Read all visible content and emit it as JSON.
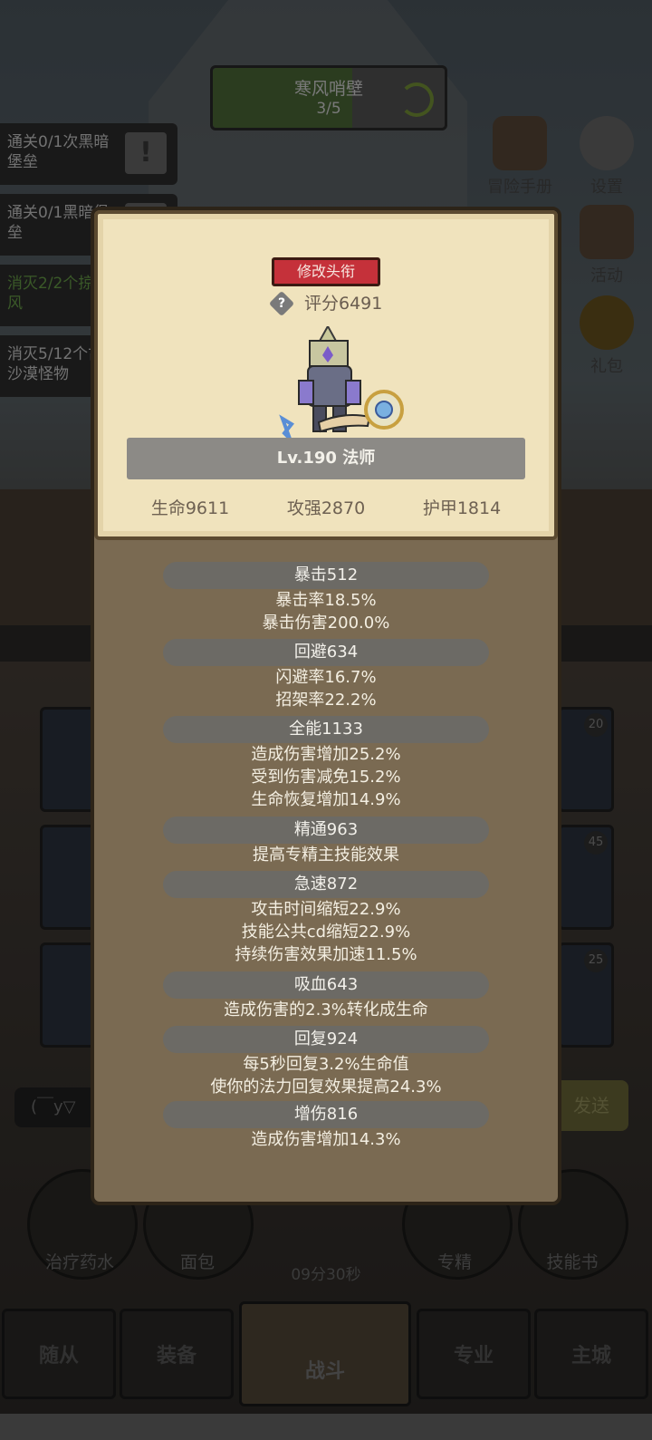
{
  "background": {
    "area": {
      "name": "寒风哨壁",
      "progress": "3/5",
      "progress_fraction": 0.6
    },
    "quests": [
      {
        "text": "通关0/1次黑暗堡垒",
        "done": false
      },
      {
        "text": "通关0/1黑暗堡垒",
        "done": false
      },
      {
        "text": "消灭2/2个掠之风",
        "done": true
      },
      {
        "text": "消灭5/12个古沙漠怪物",
        "done": false
      }
    ],
    "side_buttons": [
      "冒险手册",
      "设置",
      "活动",
      "礼包"
    ],
    "skill_slot_levels": [
      "20",
      "45",
      "25"
    ],
    "chat_placeholder": "(￣y▽",
    "send_label": "发送",
    "items": [
      "治疗药水",
      "面包",
      "专精",
      "技能书"
    ],
    "timer": "09分30秒",
    "nav": [
      "随从",
      "装备",
      "战斗",
      "专业",
      "主城"
    ]
  },
  "profile": {
    "rename_button": "修改头衔",
    "help_icon": "question-diamond-icon",
    "score": "评分6491",
    "level_class": "Lv.190 法师",
    "base_stats": [
      "生命9611",
      "攻强2870",
      "护甲1814"
    ]
  },
  "stats": [
    {
      "head": "暴击512",
      "lines": [
        "暴击率18.5%",
        "暴击伤害200.0%"
      ]
    },
    {
      "head": "回避634",
      "lines": [
        "闪避率16.7%",
        "招架率22.2%"
      ]
    },
    {
      "head": "全能1133",
      "lines": [
        "造成伤害增加25.2%",
        "受到伤害减免15.2%",
        "生命恢复增加14.9%"
      ]
    },
    {
      "head": "精通963",
      "lines": [
        "提高专精主技能效果"
      ]
    },
    {
      "head": "急速872",
      "lines": [
        "攻击时间缩短22.9%",
        "技能公共cd缩短22.9%",
        "持续伤害效果加速11.5%"
      ]
    },
    {
      "head": "吸血643",
      "lines": [
        "造成伤害的2.3%转化成生命"
      ]
    },
    {
      "head": "回复924",
      "lines": [
        "每5秒回复3.2%生命值",
        "使你的法力回复效果提高24.3%"
      ]
    },
    {
      "head": "增伤816",
      "lines": [
        "造成伤害增加14.3%"
      ]
    }
  ]
}
